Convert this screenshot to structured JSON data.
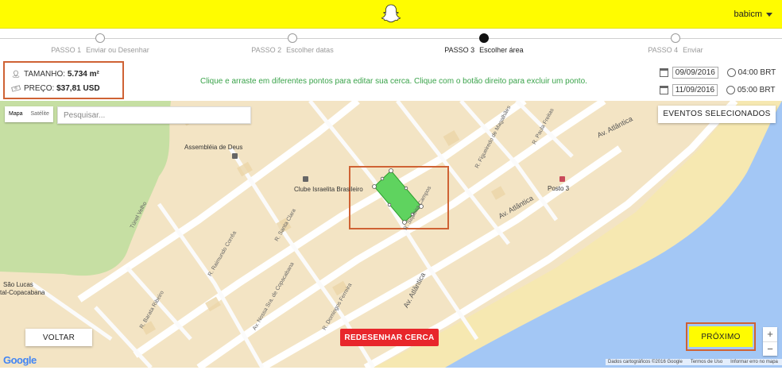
{
  "header": {
    "user_name": "babicm",
    "logo_icon": "snapchat-ghost-icon"
  },
  "steps": [
    {
      "num": "PASSO 1",
      "label": "Enviar ou Desenhar"
    },
    {
      "num": "PASSO 2",
      "label": "Escolher datas"
    },
    {
      "num": "PASSO 3",
      "label": "Escolher área"
    },
    {
      "num": "PASSO 4",
      "label": "Enviar"
    }
  ],
  "active_step": 3,
  "info": {
    "size_label": "TAMANHO:",
    "size_value": "5.734 m²",
    "price_label": "PREÇO:",
    "price_value": "$37,81 USD"
  },
  "hint": "Clique e arraste em diferentes pontos para editar sua cerca. Clique com o botão direito para excluir um ponto.",
  "dates": {
    "start_date": "09/09/2016",
    "start_time": "04:00 BRT",
    "end_date": "11/09/2016",
    "end_time": "05:00 BRT"
  },
  "map": {
    "type_map": "Mapa",
    "type_satellite": "Satélite",
    "search_placeholder": "Pesquisar...",
    "events_button": "EVENTOS SELECIONADOS",
    "back_button": "VOLTAR",
    "redraw_button": "REDESENHAR CERCA",
    "next_button": "PRÓXIMO",
    "zoom_in": "+",
    "zoom_out": "−",
    "google": "Google",
    "attribution_data": "Dados cartográficos ©2016 Google",
    "attribution_terms": "Termos de Uso",
    "attribution_report": "Informar erro no mapa",
    "places": {
      "assembleia": "Assembléia de Deus",
      "clube": "Clube Israelita Brasileiro",
      "posto3": "Posto 3",
      "sao_lucas": "São Lucas",
      "tal_copacabana": "tal-Copacabana"
    },
    "streets": {
      "av_atlantica_1": "Av. Atlântica",
      "av_atlantica_2": "Av. Atlântica",
      "av_atlantica_3": "Av. Atlântica",
      "nsa_copacabana": "Av. Nossa Sra. de Copacabana",
      "domingos_ferreira": "R. Domingos Ferreira",
      "barata_ribeiro": "R. Barata Ribeiro",
      "tunel_velho": "Túnel Velho",
      "raimundo_correa": "R. Raimundo Corrêa",
      "santa_clara": "R. Santa Clara",
      "siqueira_campos": "R. Siqueira Campos",
      "figueiredo_magalhaes": "R. Figueiredo de Magalhães",
      "paula_freitas": "R. Paula Freitas"
    },
    "colors": {
      "fence_fill": "#5fd35f",
      "highlight_border": "#cf6234",
      "ocean": "#a3c7f5",
      "beach": "#f6e8b1",
      "park": "#c6dfa3",
      "header": "#fffc00",
      "redraw": "#e8262b"
    }
  }
}
